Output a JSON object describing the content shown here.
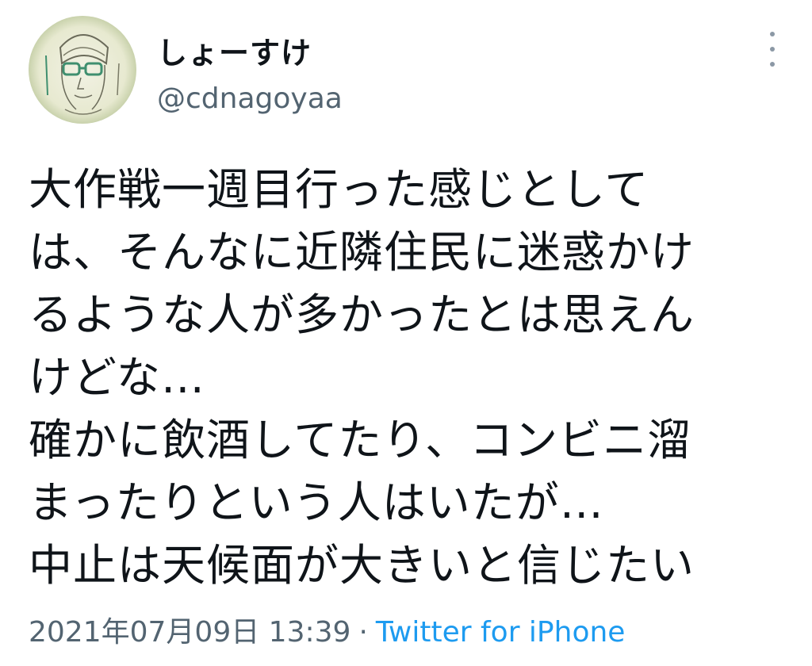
{
  "user": {
    "display_name": "しょーすけ",
    "handle": "@cdnagoyaa",
    "avatar_icon": "avatar-portrait-sketch"
  },
  "tweet": {
    "lines": [
      "大作戦一週目行った感じとして",
      "は、そんなに近隣住民に迷惑かけ",
      "るような人が多かったとは思えん",
      "けどな…",
      "確かに飲酒してたり、コンビニ溜",
      "まったりという人はいたが…",
      "中止は天候面が大きいと信じたい"
    ]
  },
  "meta": {
    "timestamp": "2021年07月09日 13:39",
    "separator": "·",
    "source": "Twitter for iPhone"
  },
  "colors": {
    "text": "#0f1419",
    "secondary": "#536471",
    "link": "#1d9bf0"
  },
  "icons": {
    "more": "more-vertical-icon"
  }
}
